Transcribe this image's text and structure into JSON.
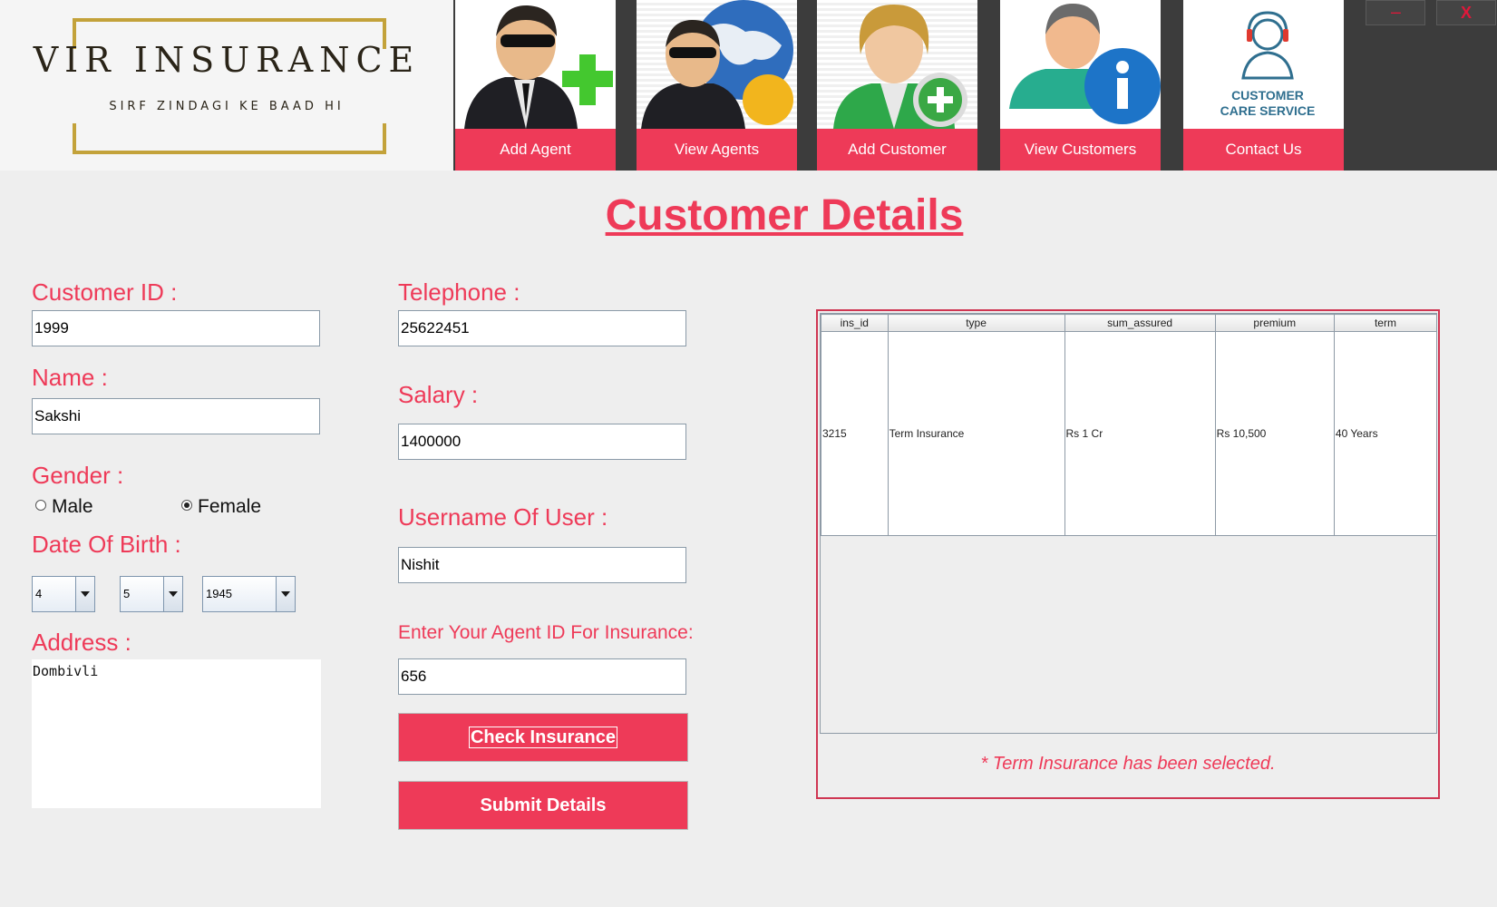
{
  "logo": {
    "title": "VIR INSURANCE",
    "tagline": "SIRF ZINDAGI KE BAAD HI"
  },
  "nav": [
    {
      "label": "Add Agent",
      "icon": "agent-add-icon"
    },
    {
      "label": "View Agents",
      "icon": "agents-globe-icon"
    },
    {
      "label": "Add Customer",
      "icon": "customer-add-icon"
    },
    {
      "label": "View Customers",
      "icon": "customer-info-icon"
    },
    {
      "label": "Contact Us",
      "icon": "customer-care-headset-icon",
      "caption_line1": "CUSTOMER",
      "caption_line2": "CARE SERVICE"
    }
  ],
  "window": {
    "minimize": "----",
    "close": "X"
  },
  "page_title": "Customer Details",
  "form": {
    "customer_id_label": "Customer ID :",
    "customer_id": "1999",
    "name_label": "Name :",
    "name": "Sakshi",
    "gender_label": "Gender :",
    "gender_options": [
      "Male",
      "Female"
    ],
    "gender_selected": "Female",
    "dob_label": "Date Of Birth :",
    "dob_day": "4",
    "dob_month": "5",
    "dob_year": "1945",
    "address_label": "Address :",
    "address": "Dombivli",
    "telephone_label": "Telephone :",
    "telephone": "25622451",
    "salary_label": "Salary :",
    "salary": "1400000",
    "username_label": "Username Of User :",
    "username": "Nishit",
    "agent_id_label": "Enter Your Agent ID For Insurance:",
    "agent_id": "656",
    "check_button": "Check Insurance",
    "submit_button": "Submit Details"
  },
  "insurance_table": {
    "columns": [
      "ins_id",
      "type",
      "sum_assured",
      "premium",
      "term"
    ],
    "rows": [
      [
        "3215",
        "Term Insurance",
        "Rs 1 Cr",
        "Rs 10,500",
        "40 Years"
      ]
    ]
  },
  "selection_note": "* Term Insurance has been selected.",
  "colors": {
    "accent": "#ee3a58",
    "header_bg": "#3c3c3c",
    "logo_gold": "#c3a23a"
  }
}
